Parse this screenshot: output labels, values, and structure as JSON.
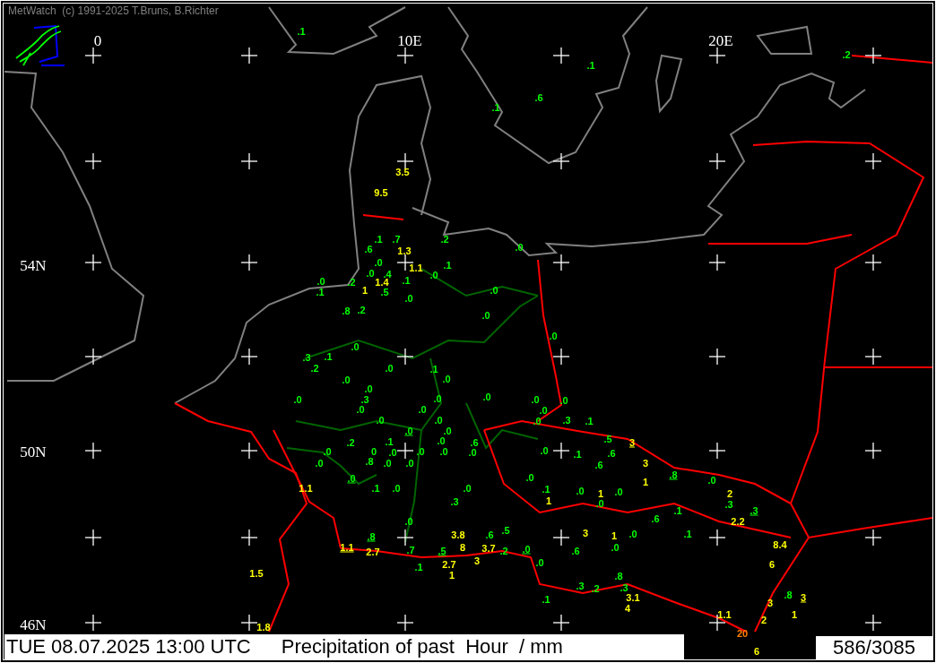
{
  "header": {
    "copyright": "MetWatch  (c) 1991-2025 T.Bruns, B.Richter"
  },
  "grid_labels": {
    "longitudes": [
      "0",
      "10E",
      "20E"
    ],
    "latitudes": [
      "54N",
      "50N",
      "46N"
    ]
  },
  "stations": [
    {
      "value": ".1",
      "color": "#00ff00",
      "underlined": false
    },
    {
      "value": ".2",
      "color": "#00ff00",
      "underlined": false
    },
    {
      "value": ".1",
      "color": "#00ff00",
      "underlined": false
    },
    {
      "value": ".6",
      "color": "#00ff00",
      "underlined": false
    },
    {
      "value": ".1",
      "color": "#00ff00",
      "underlined": false
    },
    {
      "value": "3.5",
      "color": "#ffff00",
      "underlined": false
    },
    {
      "value": "9.5",
      "color": "#ffff00",
      "underlined": false
    },
    {
      "value": ".1",
      "color": "#00ff00",
      "underlined": false
    },
    {
      "value": ".7",
      "color": "#00ff00",
      "underlined": false
    },
    {
      "value": ".2",
      "color": "#00ff00",
      "underlined": false
    },
    {
      "value": ".6",
      "color": "#00ff00",
      "underlined": false
    },
    {
      "value": "1.3",
      "color": "#ffff00",
      "underlined": false
    },
    {
      "value": ".0",
      "color": "#00ff00",
      "underlined": false
    },
    {
      "value": ".0",
      "color": "#00ff00",
      "underlined": false
    },
    {
      "value": "1.1",
      "color": "#ffff00",
      "underlined": false
    },
    {
      "value": ".1",
      "color": "#00ff00",
      "underlined": false
    },
    {
      "value": ".0",
      "color": "#00ff00",
      "underlined": false
    },
    {
      "value": ".4",
      "color": "#00ff00",
      "underlined": false
    },
    {
      "value": ".0",
      "color": "#00ff00",
      "underlined": false
    },
    {
      "value": ".0",
      "color": "#00ff00",
      "underlined": false
    },
    {
      "value": ".2",
      "color": "#00ff00",
      "underlined": false
    },
    {
      "value": "1.4",
      "color": "#ffff00",
      "underlined": false
    },
    {
      "value": ".1",
      "color": "#00ff00",
      "underlined": false
    },
    {
      "value": ".1",
      "color": "#00ff00",
      "underlined": false
    },
    {
      "value": "1",
      "color": "#ffff00",
      "underlined": false
    },
    {
      "value": ".5",
      "color": "#00ff00",
      "underlined": false
    },
    {
      "value": ".0",
      "color": "#00ff00",
      "underlined": false
    },
    {
      "value": ".0",
      "color": "#00ff00",
      "underlined": false
    },
    {
      "value": ".8",
      "color": "#00ff00",
      "underlined": false
    },
    {
      "value": ".2",
      "color": "#00ff00",
      "underlined": false
    },
    {
      "value": ".0",
      "color": "#00ff00",
      "underlined": false
    },
    {
      "value": ".0",
      "color": "#00ff00",
      "underlined": false
    },
    {
      "value": ".0",
      "color": "#00ff00",
      "underlined": false
    },
    {
      "value": ".3",
      "color": "#00ff00",
      "underlined": false
    },
    {
      "value": ".1",
      "color": "#00ff00",
      "underlined": false
    },
    {
      "value": ".2",
      "color": "#00ff00",
      "underlined": false
    },
    {
      "value": ".0",
      "color": "#00ff00",
      "underlined": false
    },
    {
      "value": ".1",
      "color": "#00ff00",
      "underlined": false
    },
    {
      "value": ".0",
      "color": "#00ff00",
      "underlined": false
    },
    {
      "value": ".0",
      "color": "#00ff00",
      "underlined": false
    },
    {
      "value": ".0",
      "color": "#00ff00",
      "underlined": false
    },
    {
      "value": ".0",
      "color": "#00ff00",
      "underlined": false
    },
    {
      "value": ".3",
      "color": "#00ff00",
      "underlined": false
    },
    {
      "value": ".0",
      "color": "#00ff00",
      "underlined": false
    },
    {
      "value": ".0",
      "color": "#00ff00",
      "underlined": false
    },
    {
      "value": ".0",
      "color": "#00ff00",
      "underlined": false
    },
    {
      "value": ".0",
      "color": "#00ff00",
      "underlined": false
    },
    {
      "value": ".0",
      "color": "#00ff00",
      "underlined": false
    },
    {
      "value": ".0",
      "color": "#00ff00",
      "underlined": false
    },
    {
      "value": ".0",
      "color": "#00ff00",
      "underlined": false
    },
    {
      "value": ".0",
      "color": "#00ff00",
      "underlined": false
    },
    {
      "value": ".0",
      "color": "#00ff00",
      "underlined": false
    },
    {
      "value": ".0",
      "color": "#00ff00",
      "underlined": false
    },
    {
      "value": ".3",
      "color": "#00ff00",
      "underlined": false
    },
    {
      "value": ".1",
      "color": "#00ff00",
      "underlined": false
    },
    {
      "value": ".0",
      "color": "#00ff00",
      "underlined": true
    },
    {
      "value": ".0",
      "color": "#00ff00",
      "underlined": false
    },
    {
      "value": ".2",
      "color": "#00ff00",
      "underlined": false
    },
    {
      "value": ".1",
      "color": "#00ff00",
      "underlined": false
    },
    {
      "value": ".0",
      "color": "#00ff00",
      "underlined": false
    },
    {
      "value": ".6",
      "color": "#00ff00",
      "underlined": false
    },
    {
      "value": ".5",
      "color": "#00ff00",
      "underlined": false
    },
    {
      "value": "3",
      "color": "#ffff00",
      "underlined": true
    },
    {
      "value": ".0",
      "color": "#00ff00",
      "underlined": false
    },
    {
      "value": "0",
      "color": "#00ff00",
      "underlined": false
    },
    {
      "value": ".0",
      "color": "#00ff00",
      "underlined": false
    },
    {
      "value": ".0",
      "color": "#00ff00",
      "underlined": false
    },
    {
      "value": ".0",
      "color": "#00ff00",
      "underlined": false
    },
    {
      "value": ".0",
      "color": "#00ff00",
      "underlined": false
    },
    {
      "value": ".0",
      "color": "#00ff00",
      "underlined": false
    },
    {
      "value": ".1",
      "color": "#00ff00",
      "underlined": false
    },
    {
      "value": ".6",
      "color": "#00ff00",
      "underlined": false
    },
    {
      "value": ".0",
      "color": "#00ff00",
      "underlined": false
    },
    {
      "value": ".8",
      "color": "#00ff00",
      "underlined": false
    },
    {
      "value": ".0",
      "color": "#00ff00",
      "underlined": false
    },
    {
      "value": ".0",
      "color": "#00ff00",
      "underlined": false
    },
    {
      "value": ".6",
      "color": "#00ff00",
      "underlined": false
    },
    {
      "value": "3",
      "color": "#ffff00",
      "underlined": false
    },
    {
      "value": ".0",
      "color": "#00ff00",
      "underlined": true
    },
    {
      "value": ".0",
      "color": "#00ff00",
      "underlined": false
    },
    {
      "value": "1",
      "color": "#ffff00",
      "underlined": false
    },
    {
      "value": ".8",
      "color": "#00ff00",
      "underlined": true
    },
    {
      "value": ".0",
      "color": "#00ff00",
      "underlined": false
    },
    {
      "value": "1.1",
      "color": "#ffff00",
      "underlined": false
    },
    {
      "value": ".1",
      "color": "#00ff00",
      "underlined": false
    },
    {
      "value": ".0",
      "color": "#00ff00",
      "underlined": false
    },
    {
      "value": ".0",
      "color": "#00ff00",
      "underlined": false
    },
    {
      "value": ".1",
      "color": "#00ff00",
      "underlined": false
    },
    {
      "value": ".0",
      "color": "#00ff00",
      "underlined": false
    },
    {
      "value": "1",
      "color": "#ffff00",
      "underlined": false
    },
    {
      "value": ".0",
      "color": "#00ff00",
      "underlined": false
    },
    {
      "value": "2",
      "color": "#ffff00",
      "underlined": false
    },
    {
      "value": ".3",
      "color": "#00ff00",
      "underlined": false
    },
    {
      "value": "1",
      "color": "#ffff00",
      "underlined": false
    },
    {
      "value": ".0",
      "color": "#00ff00",
      "underlined": false
    },
    {
      "value": ".3",
      "color": "#00ff00",
      "underlined": false
    },
    {
      "value": ".1",
      "color": "#00ff00",
      "underlined": false
    },
    {
      "value": ".3",
      "color": "#00ff00",
      "underlined": true
    },
    {
      "value": ".0",
      "color": "#00ff00",
      "underlined": false
    },
    {
      "value": ".6",
      "color": "#00ff00",
      "underlined": false
    },
    {
      "value": "2.2",
      "color": "#ffff00",
      "underlined": false
    },
    {
      "value": ".8",
      "color": "#00ff00",
      "underlined": true
    },
    {
      "value": "3.8",
      "color": "#ffff00",
      "underlined": false
    },
    {
      "value": ".6",
      "color": "#00ff00",
      "underlined": false
    },
    {
      "value": ".5",
      "color": "#00ff00",
      "underlined": false
    },
    {
      "value": "3",
      "color": "#ffff00",
      "underlined": false
    },
    {
      "value": "1",
      "color": "#ffff00",
      "underlined": false
    },
    {
      "value": ".0",
      "color": "#00ff00",
      "underlined": false
    },
    {
      "value": ".1",
      "color": "#00ff00",
      "underlined": false
    },
    {
      "value": "1.1",
      "color": "#ffff00",
      "underlined": true
    },
    {
      "value": "2.7",
      "color": "#ffff00",
      "underlined": false
    },
    {
      "value": ".7",
      "color": "#00ff00",
      "underlined": false
    },
    {
      "value": ".5",
      "color": "#00ff00",
      "underlined": true
    },
    {
      "value": "8",
      "color": "#ffff00",
      "underlined": false
    },
    {
      "value": "3.7",
      "color": "#ffff00",
      "underlined": false
    },
    {
      "value": ".2",
      "color": "#00ff00",
      "underlined": false
    },
    {
      "value": ".0",
      "color": "#00ff00",
      "underlined": true
    },
    {
      "value": ".6",
      "color": "#00ff00",
      "underlined": false
    },
    {
      "value": ".0",
      "color": "#00ff00",
      "underlined": false
    },
    {
      "value": "8.4",
      "color": "#ffff00",
      "underlined": false
    },
    {
      "value": ".1",
      "color": "#00ff00",
      "underlined": false
    },
    {
      "value": "2.7",
      "color": "#ffff00",
      "underlined": false
    },
    {
      "value": "3",
      "color": "#ffff00",
      "underlined": false
    },
    {
      "value": ".0",
      "color": "#00ff00",
      "underlined": false
    },
    {
      "value": "6",
      "color": "#ffff00",
      "underlined": false
    },
    {
      "value": "1.5",
      "color": "#ffff00",
      "underlined": false
    },
    {
      "value": "1",
      "color": "#ffff00",
      "underlined": false
    },
    {
      "value": ".8",
      "color": "#00ff00",
      "underlined": false
    },
    {
      "value": ".3",
      "color": "#00ff00",
      "underlined": false
    },
    {
      "value": ".2",
      "color": "#00ff00",
      "underlined": false
    },
    {
      "value": ".3",
      "color": "#00ff00",
      "underlined": false
    },
    {
      "value": ".1",
      "color": "#00ff00",
      "underlined": false
    },
    {
      "value": "3.1",
      "color": "#ffff00",
      "underlined": false
    },
    {
      "value": "3",
      "color": "#ffff00",
      "underlined": false
    },
    {
      "value": ".8",
      "color": "#00ff00",
      "underlined": false
    },
    {
      "value": "3",
      "color": "#ffff00",
      "underlined": true
    },
    {
      "value": "4",
      "color": "#ffff00",
      "underlined": false
    },
    {
      "value": "1.1",
      "color": "#ffff00",
      "underlined": false
    },
    {
      "value": "2",
      "color": "#ffff00",
      "underlined": false
    },
    {
      "value": "1",
      "color": "#ffff00",
      "underlined": false
    },
    {
      "value": "1.8",
      "color": "#ffff00",
      "underlined": false
    },
    {
      "value": "20",
      "color": "#ff8000",
      "underlined": false
    },
    {
      "value": "6",
      "color": "#ffff00",
      "underlined": false
    }
  ],
  "footer": {
    "timestamp": "TUE 08.07.2025 13:00 UTC",
    "caption": "Precipitation of past  Hour  / mm",
    "count": "586/3085"
  }
}
